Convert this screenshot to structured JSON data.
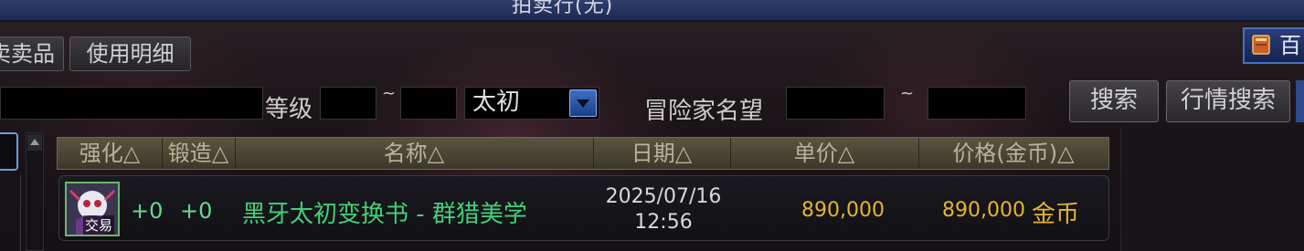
{
  "window": {
    "title": "拍卖行(无)"
  },
  "tabs": [
    {
      "label": "卖卖品"
    },
    {
      "label": "使用明细"
    }
  ],
  "top_right": {
    "label": "百"
  },
  "search": {
    "keyword_value": "",
    "level_label": "等级",
    "level_sep": "~",
    "grade_selected": "太初",
    "reputation_label": "冒险家名望",
    "reputation_sep": "~",
    "search_button": "搜索",
    "market_search_button": "行情搜索"
  },
  "table": {
    "columns": [
      "强化△",
      "锻造△",
      "名称△",
      "日期△",
      "单价△",
      "价格(金币)△"
    ],
    "rows": [
      {
        "enhance": "+0",
        "forge": "+0",
        "name": "黑牙太初变换书 - 群猎美学",
        "date": "2025/07/16",
        "time": "12:56",
        "unit_price": "890,000",
        "price": "890,000",
        "currency": "金币",
        "icon_badge": "交易"
      }
    ]
  },
  "colors": {
    "title_bar": "#1c2a52",
    "item_name": "#44d07a",
    "price": "#e6b432",
    "header": "#4a4534"
  }
}
